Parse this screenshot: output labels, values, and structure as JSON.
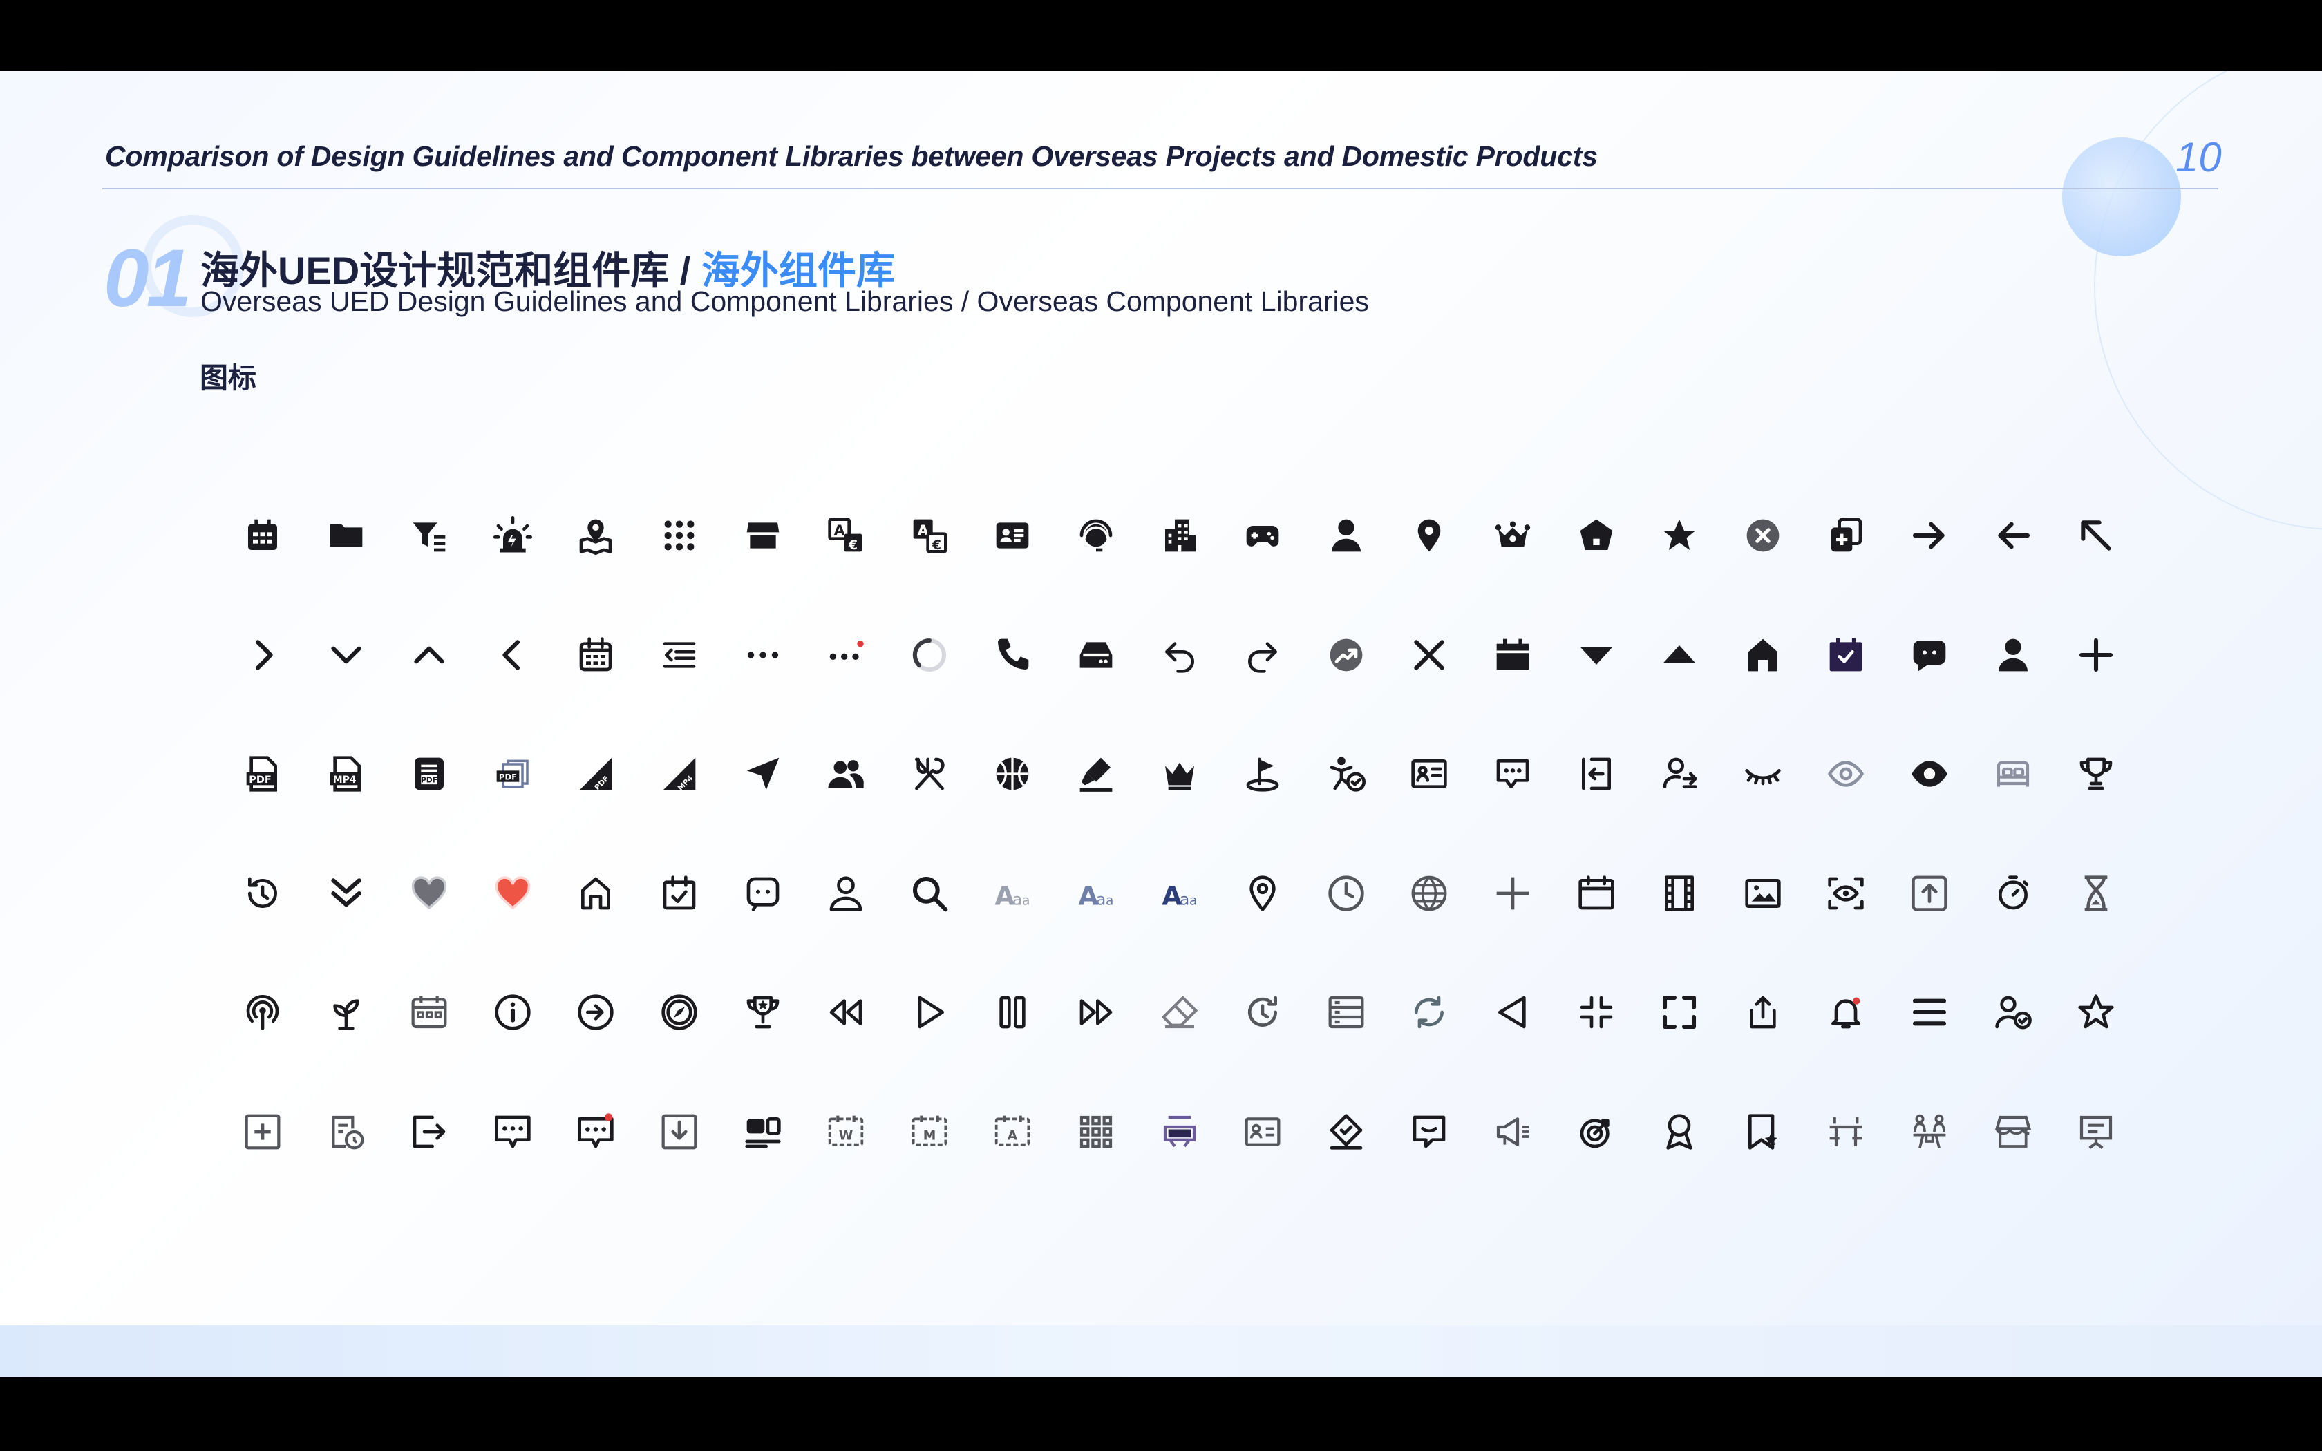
{
  "header": {
    "title": "Comparison of Design Guidelines and Component Libraries between Overseas Projects and Domestic Products",
    "page_number": "10"
  },
  "section": {
    "number": "01",
    "title_cn": "海外UED设计规范和组件库 / ",
    "title_cn_accent": "海外组件库",
    "title_en": "Overseas UED Design Guidelines and Component Libraries / Overseas Component Libraries",
    "label": "图标"
  },
  "colors": {
    "accent": "#3b8cf4",
    "text": "#1c2140",
    "icon": "#1b1b1f",
    "icon_gray": "#8b90a0",
    "red": "#e03a3a",
    "purple": "#2a1f4a"
  },
  "icons": [
    [
      "calendar-icon",
      "folder-icon",
      "filter-list-icon",
      "alarm-light-icon",
      "map-pin-icon",
      "grid-dots-icon",
      "store-icon",
      "translate-icon",
      "translate-alt-icon",
      "id-card-icon",
      "headset-globe-icon",
      "building-icon",
      "gamepad-icon",
      "user-icon",
      "location-pin-icon",
      "crown-icon",
      "pentagon-home-icon",
      "star-icon",
      "close-circle-icon",
      "copy-add-icon",
      "arrow-right-icon",
      "arrow-left-icon",
      "arrow-up-left-icon"
    ],
    [
      "chevron-right-icon",
      "chevron-down-icon",
      "chevron-up-icon",
      "chevron-left-icon",
      "calendar-outline-icon",
      "indent-list-icon",
      "more-dots-icon",
      "more-dots-badge-icon",
      "loading-spinner-icon",
      "phone-icon",
      "inbox-tray-icon",
      "undo-icon",
      "redo-icon",
      "trend-up-circle-icon",
      "close-icon",
      "calendar-box-icon",
      "caret-down-icon",
      "caret-up-icon",
      "home-icon",
      "calendar-check-icon",
      "chat-bubble-icon",
      "user-solid-icon",
      "plus-icon"
    ],
    [
      "pdf-file-icon",
      "mp4-file-icon",
      "pdf-doc-dark-icon",
      "pdf-stack-icon",
      "pdf-corner-icon",
      "mp4-corner-icon",
      "navigation-arrow-icon",
      "users-icon",
      "cutlery-icon",
      "basketball-icon",
      "highlighter-icon",
      "crown-outline-icon",
      "golf-flag-icon",
      "accessibility-check-icon",
      "contact-card-icon",
      "chat-dots-box-icon",
      "login-icon",
      "user-transfer-icon",
      "eye-closed-icon",
      "eye-outline-icon",
      "eye-solid-icon",
      "bed-icon",
      "trophy-icon"
    ],
    [
      "history-icon",
      "double-chevron-down-icon",
      "heart-gray-icon",
      "heart-red-icon",
      "home-outline-icon",
      "calendar-task-icon",
      "chat-outline-icon",
      "user-outline-icon",
      "search-icon",
      "font-size-small-icon",
      "font-size-medium-icon",
      "font-size-large-icon",
      "location-outline-icon",
      "clock-icon",
      "globe-icon",
      "plus-thin-icon",
      "calendar-blank-icon",
      "film-icon",
      "image-icon",
      "scan-eye-icon",
      "upload-box-icon",
      "timer-icon",
      "hourglass-icon"
    ],
    [
      "podcast-icon",
      "sprout-icon",
      "calendar-dots-icon",
      "info-icon",
      "arrow-circle-right-icon",
      "compass-icon",
      "trophy-star-icon",
      "rewind-icon",
      "play-icon",
      "pause-icon",
      "fast-forward-icon",
      "eraser-icon",
      "clock-refresh-icon",
      "server-list-icon",
      "sync-icon",
      "triangle-left-icon",
      "collapse-icon",
      "expand-icon",
      "share-icon",
      "bell-badge-icon",
      "menu-icon",
      "user-check-icon",
      "star-outline-icon"
    ],
    [
      "add-box-icon",
      "document-clock-icon",
      "logout-icon",
      "chat-message-icon",
      "chat-message-badge-icon",
      "download-box-icon",
      "media-cards-icon",
      "calendar-week-icon",
      "calendar-month-icon",
      "calendar-annual-icon",
      "grid-nine-icon",
      "vr-glasses-icon",
      "id-card-outline-icon",
      "diamond-check-icon",
      "chat-minus-icon",
      "megaphone-icon",
      "target-icon",
      "award-ribbon-icon",
      "bookmark-star-icon",
      "table-seats-icon",
      "group-meeting-icon",
      "shop-icon",
      "presentation-board-icon"
    ]
  ]
}
